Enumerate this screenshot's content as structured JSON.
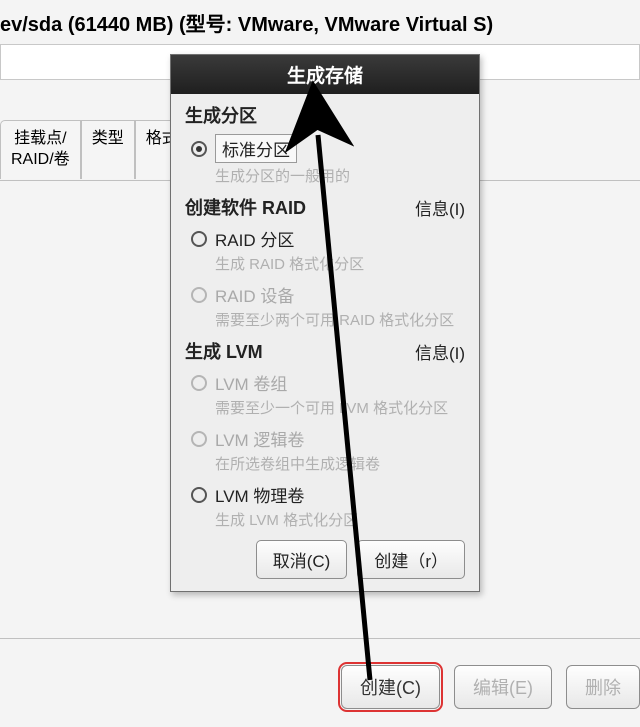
{
  "window": {
    "title_fragment": "ev/sda (61440 MB) (型号: VMware, VMware Virtual S)"
  },
  "tabs": {
    "mount_raid": "挂载点/\nRAID/卷",
    "type": "类型",
    "format": "格式"
  },
  "dialog": {
    "title": "生成存储",
    "sections": {
      "create_partition": "生成分区",
      "create_raid": "创建软件 RAID",
      "create_lvm": "生成 LVM",
      "info": "信息(I)"
    },
    "options": {
      "standard": {
        "label": "标准分区",
        "desc": "生成分区的一般用的"
      },
      "raid_part": {
        "label": "RAID 分区",
        "desc": "生成 RAID 格式化分区"
      },
      "raid_dev": {
        "label": "RAID 设备",
        "desc": "需要至少两个可用 RAID 格式化分区"
      },
      "lvm_vg": {
        "label": "LVM 卷组",
        "desc": "需要至少一个可用 LVM 格式化分区"
      },
      "lvm_lv": {
        "label": "LVM 逻辑卷",
        "desc": "在所选卷组中生成逻辑卷"
      },
      "lvm_pv": {
        "label": "LVM 物理卷",
        "desc": "生成 LVM 格式化分区"
      }
    },
    "buttons": {
      "cancel": "取消(C)",
      "create": "创建（r）"
    }
  },
  "bottom_buttons": {
    "create": "创建(C)",
    "edit": "编辑(E)",
    "delete": "删除"
  }
}
